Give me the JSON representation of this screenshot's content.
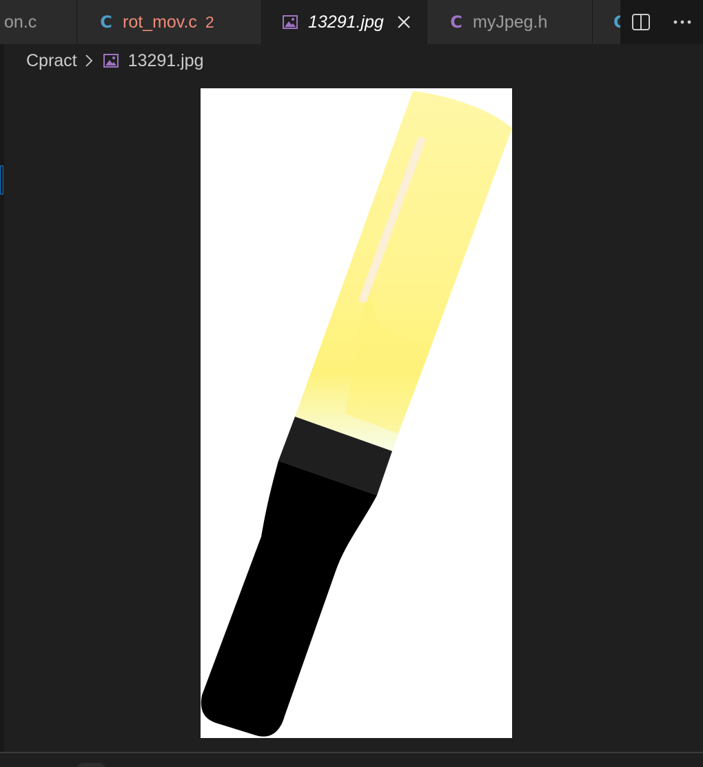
{
  "tabs": [
    {
      "label": "on.c",
      "icon": "c-file-icon",
      "active": false
    },
    {
      "label": "rot_mov.c",
      "icon": "c-file-icon",
      "problems": "2",
      "active": false
    },
    {
      "label": "13291.jpg",
      "icon": "image-file-icon",
      "active": true
    },
    {
      "label": "myJpeg.h",
      "icon": "c-header-icon",
      "active": false
    },
    {
      "label": "",
      "icon": "c-file-icon",
      "active": false
    }
  ],
  "tab_actions": {
    "split": "split-editor-icon",
    "more": "more-actions-icon"
  },
  "breadcrumb": {
    "folder": "Cpract",
    "file": "13291.jpg"
  },
  "colors": {
    "c_icon_blue": "#4d9ec9",
    "c_icon_purple": "#a074c4",
    "error_text": "#f08b7a",
    "image_background": "#ffffff",
    "lightstick_yellow": "#fff27a",
    "lightstick_handle": "#000000"
  }
}
